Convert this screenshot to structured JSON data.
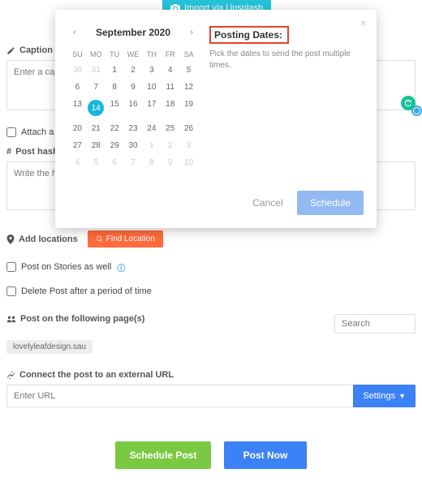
{
  "import_btn": "Import via Unsplash",
  "caption": {
    "label": "Caption",
    "placeholder": "Enter a caption"
  },
  "attach": "Attach a product",
  "hashtags": {
    "label": "Post hashtags",
    "placeholder": "Write the hashtags"
  },
  "locations": {
    "label": "Add locations",
    "button": "Find Location"
  },
  "stories": "Post on Stories as well",
  "delete_after": "Delete Post after a period of time",
  "pages": {
    "label": "Post on the following page(s)",
    "search_placeholder": "Search",
    "tag": "lovelyleafdesign.sau"
  },
  "external": {
    "label": "Connect the post to an external URL",
    "placeholder": "Enter URL",
    "settings": "Settings"
  },
  "bottom": {
    "schedule": "Schedule Post",
    "now": "Post Now"
  },
  "modal": {
    "month": "September 2020",
    "dows": [
      "SU",
      "MO",
      "TU",
      "WE",
      "TH",
      "FR",
      "SA"
    ],
    "posting_title": "Posting Dates:",
    "posting_hint": "Pick the dates to send the post multiple times.",
    "cancel": "Cancel",
    "schedule": "Schedule",
    "grid": [
      {
        "n": "30",
        "dim": true
      },
      {
        "n": "31",
        "dim": true
      },
      {
        "n": "1"
      },
      {
        "n": "2"
      },
      {
        "n": "3"
      },
      {
        "n": "4"
      },
      {
        "n": "5"
      },
      {
        "n": "6"
      },
      {
        "n": "7"
      },
      {
        "n": "8"
      },
      {
        "n": "9"
      },
      {
        "n": "10"
      },
      {
        "n": "11"
      },
      {
        "n": "12"
      },
      {
        "n": "13"
      },
      {
        "n": "14",
        "sel": true
      },
      {
        "n": "15"
      },
      {
        "n": "16"
      },
      {
        "n": "17"
      },
      {
        "n": "18"
      },
      {
        "n": "19"
      },
      {
        "n": "20"
      },
      {
        "n": "21"
      },
      {
        "n": "22"
      },
      {
        "n": "23"
      },
      {
        "n": "24"
      },
      {
        "n": "25"
      },
      {
        "n": "26"
      },
      {
        "n": "27"
      },
      {
        "n": "28"
      },
      {
        "n": "29"
      },
      {
        "n": "30"
      },
      {
        "n": "1",
        "dim": true
      },
      {
        "n": "2",
        "dim": true
      },
      {
        "n": "3",
        "dim": true
      },
      {
        "n": "4",
        "dim": true
      },
      {
        "n": "5",
        "dim": true
      },
      {
        "n": "6",
        "dim": true
      },
      {
        "n": "7",
        "dim": true
      },
      {
        "n": "8",
        "dim": true
      },
      {
        "n": "9",
        "dim": true
      },
      {
        "n": "10",
        "dim": true
      }
    ]
  }
}
